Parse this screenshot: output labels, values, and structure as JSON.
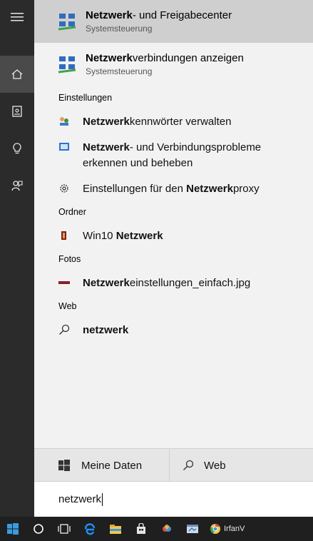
{
  "top_results": [
    {
      "title_bold": "Netzwerk",
      "title_rest": "- und Freigabecenter",
      "subtitle": "Systemsteuerung"
    },
    {
      "title_bold": "Netzwerk",
      "title_rest": "verbindungen anzeigen",
      "subtitle": "Systemsteuerung"
    }
  ],
  "sections": {
    "settings": {
      "header": "Einstellungen",
      "items": [
        {
          "bold": "Netzwerk",
          "rest": "kennwörter verwalten"
        },
        {
          "bold": "Netzwerk",
          "rest": "- und Verbindungsprobleme",
          "line2": "erkennen und beheben"
        },
        {
          "pre": "Einstellungen für den ",
          "bold": "Netzwerk",
          "rest": "proxy"
        }
      ]
    },
    "folders": {
      "header": "Ordner",
      "item_pre": "Win10 ",
      "item_bold": "Netzwerk"
    },
    "photos": {
      "header": "Fotos",
      "item_bold": "Netzwerk",
      "item_rest": "einstellungen_einfach.jpg"
    },
    "web": {
      "header": "Web",
      "item": "netzwerk"
    }
  },
  "tabs": {
    "my_data": "Meine Daten",
    "web": "Web"
  },
  "search": {
    "query": "netzwerk"
  },
  "taskbar": {
    "irfan_label": "IrfanV"
  },
  "colors": {
    "sidebar": "#2b2b2b",
    "highlight": "#cfcfcf",
    "taskbar": "#1f1f1f"
  }
}
